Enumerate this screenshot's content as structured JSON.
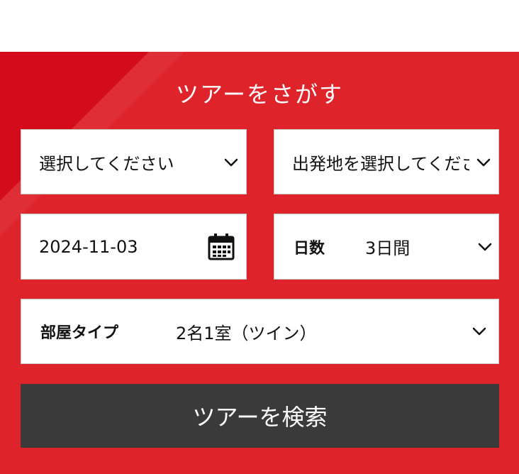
{
  "header": {
    "title": "ツアーをさがす"
  },
  "form": {
    "select1": {
      "value": "選択してください",
      "icon": "chevron-down-icon"
    },
    "select2": {
      "value": "出発地を選択してください",
      "icon": "chevron-down-icon"
    },
    "date": {
      "value": "2024-11-03",
      "icon": "calendar-icon"
    },
    "days": {
      "label": "日数",
      "value": "3日間",
      "icon": "chevron-down-icon"
    },
    "room": {
      "label": "部屋タイプ",
      "value": "2名1室（ツイン）",
      "icon": "chevron-down-icon"
    },
    "search_label": "ツアーを検索"
  },
  "colors": {
    "panel_bg": "#de232b",
    "panel_accent": "#d40b1a",
    "button_bg": "#3a3a3a",
    "text_on_red": "#ffffff"
  }
}
